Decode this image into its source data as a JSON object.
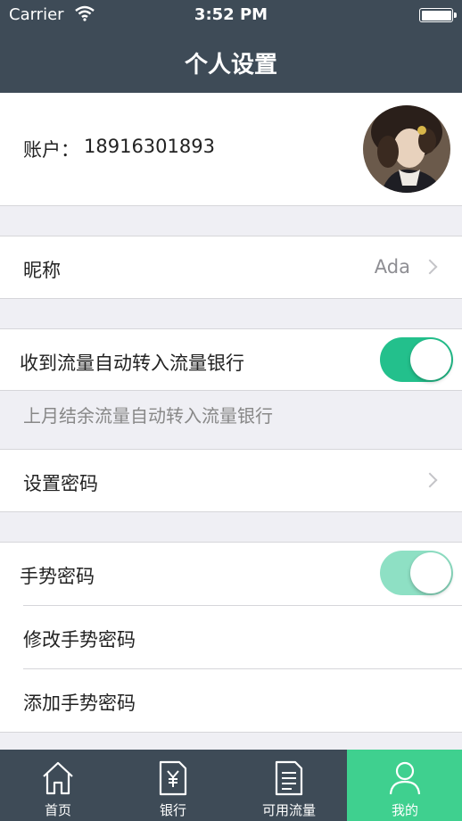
{
  "status_bar": {
    "carrier": "Carrier",
    "time": "3:52 PM"
  },
  "nav": {
    "title": "个人设置"
  },
  "account": {
    "label": "账户：",
    "value": "18916301893"
  },
  "nickname": {
    "label": "昵称",
    "value": "Ada"
  },
  "auto_transfer": {
    "label": "收到流量自动转入流量银行",
    "enabled": true
  },
  "note": "上月结余流量自动转入流量银行",
  "set_password": {
    "label": "设置密码"
  },
  "gesture": {
    "label": "手势密码",
    "enabled": true,
    "modify_label": "修改手势密码",
    "add_label": "添加手势密码"
  },
  "tabs": [
    {
      "label": "首页",
      "icon": "home-icon"
    },
    {
      "label": "银行",
      "icon": "bank-doc-icon"
    },
    {
      "label": "可用流量",
      "icon": "document-icon"
    },
    {
      "label": "我的",
      "icon": "user-icon",
      "active": true
    }
  ],
  "colors": {
    "header": "#3e4b57",
    "accent": "#23c08c",
    "active_tab": "#3fd08f"
  }
}
